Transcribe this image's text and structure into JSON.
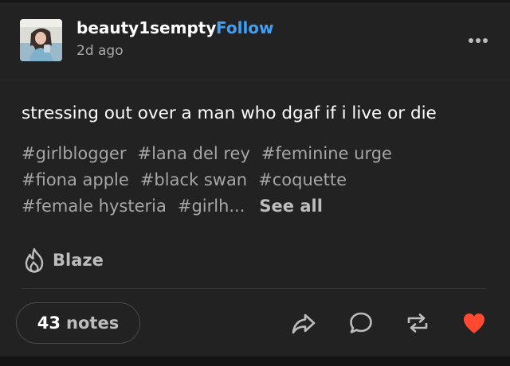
{
  "post": {
    "author": "beauty1sempty",
    "follow_label": "Follow",
    "timestamp": "2d ago",
    "text": "stressing out over a man who dgaf if i live or die",
    "tags": [
      "#girlblogger",
      "#lana del rey",
      "#feminine urge",
      "#fiona apple",
      "#black swan",
      "#coquette",
      "#female hysteria",
      "#girlh..."
    ],
    "see_all_label": "See all"
  },
  "footer": {
    "blaze_label": "Blaze",
    "notes_count": "43",
    "notes_label": "notes"
  },
  "icons": {
    "more": "more-horizontal-icon",
    "blaze": "flame-icon",
    "share": "share-arrow-icon",
    "reply": "reply-bubble-icon",
    "reblog": "reblog-icon",
    "like": "heart-icon"
  },
  "colors": {
    "background": "#222222",
    "follow_accent": "#3e9ff5",
    "like_active": "#ff4930",
    "tag_text": "#a6a6a6",
    "muted_text": "#a8a8a8"
  }
}
